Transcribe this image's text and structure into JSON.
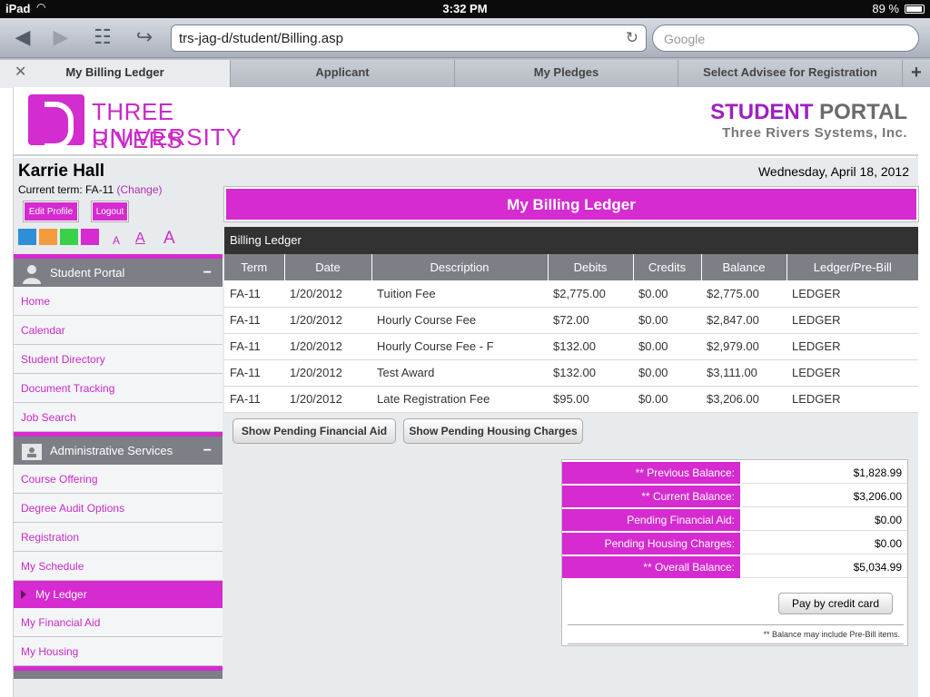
{
  "status_bar": {
    "device": "iPad",
    "time": "3:32 PM",
    "battery": "89 %"
  },
  "browser": {
    "url": "trs-jag-d/student/Billing.asp",
    "search_placeholder": "Google",
    "tabs": [
      {
        "label": "My Billing Ledger",
        "active": true
      },
      {
        "label": "Applicant",
        "active": false
      },
      {
        "label": "My Pledges",
        "active": false
      },
      {
        "label": "Select Advisee for Registration",
        "active": false
      }
    ]
  },
  "header": {
    "logo_line1": "THREE RIVERS",
    "logo_line2": "UNIVERSITY",
    "portal_part1": "STUDENT",
    "portal_part2": "PORTAL",
    "portal_sub": "Three Rivers Systems, Inc."
  },
  "user": {
    "name": "Karrie Hall",
    "term_label": "Current term: FA-11",
    "change_label": "(Change)",
    "edit_profile_label": "Edit Profile",
    "logout_label": "Logout",
    "font_a": "A"
  },
  "date": "Wednesday, April 18, 2012",
  "colors": {
    "accent": "#d52bd0",
    "blue": "#2f8fd6",
    "orange": "#f39a3c",
    "green": "#3ad14a",
    "magenta": "#d52bd0"
  },
  "sidebar": {
    "sections": [
      {
        "title": "Student Portal",
        "icon": "person-icon",
        "items": [
          "Home",
          "Calendar",
          "Student Directory",
          "Document Tracking",
          "Job Search"
        ]
      },
      {
        "title": "Administrative Services",
        "icon": "folder-icon",
        "items": [
          "Course Offering",
          "Degree Audit Options",
          "Registration",
          "My Schedule",
          "My Ledger",
          "My Financial Aid",
          "My Housing"
        ],
        "active_item": "My Ledger"
      }
    ],
    "collapse_symbol": "−"
  },
  "main": {
    "title": "My Billing Ledger",
    "ledger_heading": "Billing Ledger",
    "columns": [
      "Term",
      "Date",
      "Description",
      "Debits",
      "Credits",
      "Balance",
      "Ledger/Pre-Bill"
    ],
    "rows": [
      [
        "FA-11",
        "1/20/2012",
        "Tuition Fee",
        "$2,775.00",
        "$0.00",
        "$2,775.00",
        "LEDGER"
      ],
      [
        "FA-11",
        "1/20/2012",
        "Hourly Course Fee",
        "$72.00",
        "$0.00",
        "$2,847.00",
        "LEDGER"
      ],
      [
        "FA-11",
        "1/20/2012",
        "Hourly Course Fee - F",
        "$132.00",
        "$0.00",
        "$2,979.00",
        "LEDGER"
      ],
      [
        "FA-11",
        "1/20/2012",
        "Test Award",
        "$132.00",
        "$0.00",
        "$3,111.00",
        "LEDGER"
      ],
      [
        "FA-11",
        "1/20/2012",
        "Late Registration Fee",
        "$95.00",
        "$0.00",
        "$3,206.00",
        "LEDGER"
      ]
    ],
    "show_aid_label": "Show Pending Financial Aid",
    "show_housing_label": "Show Pending Housing Charges",
    "balances": [
      {
        "label": "** Previous Balance:",
        "value": "$1,828.99"
      },
      {
        "label": "** Current Balance:",
        "value": "$3,206.00"
      },
      {
        "label": "Pending Financial Aid:",
        "value": "$0.00"
      },
      {
        "label": "Pending Housing Charges:",
        "value": "$0.00"
      },
      {
        "label": "** Overall Balance:",
        "value": "$5,034.99"
      }
    ],
    "pay_label": "Pay by credit card",
    "note": "** Balance may include Pre-Bill items."
  }
}
